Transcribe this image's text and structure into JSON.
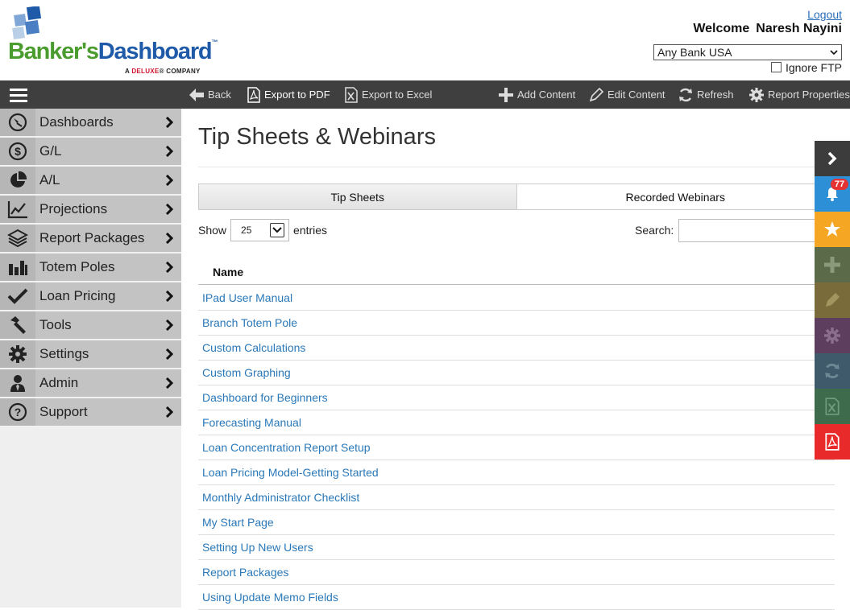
{
  "header": {
    "logo_text_1": "Banker's",
    "logo_text_2": "Dashboard",
    "logo_tm": "™",
    "logo_sub_1": "A",
    "logo_sub_2": "DELUXE",
    "logo_sub_3": "® COMPANY",
    "logout": "Logout",
    "welcome": "Welcome",
    "user_name": "Naresh Nayini",
    "bank": "Any Bank USA",
    "ignore_ftp": "Ignore FTP"
  },
  "toolbar": {
    "back": "Back",
    "export_pdf": "Export to PDF",
    "export_excel": "Export to Excel",
    "add_content": "Add Content",
    "edit_content": "Edit Content",
    "refresh": "Refresh",
    "report_properties": "Report Properties"
  },
  "sidebar": {
    "items": [
      {
        "label": "Dashboards",
        "icon": "dashboard-icon"
      },
      {
        "label": "G/L",
        "icon": "dollar-icon"
      },
      {
        "label": "A/L",
        "icon": "pie-icon"
      },
      {
        "label": "Projections",
        "icon": "line-chart-icon"
      },
      {
        "label": "Report Packages",
        "icon": "layers-icon"
      },
      {
        "label": "Totem Poles",
        "icon": "bar-chart-icon"
      },
      {
        "label": "Loan Pricing",
        "icon": "check-icon"
      },
      {
        "label": "Tools",
        "icon": "hammer-icon"
      },
      {
        "label": "Settings",
        "icon": "gear-icon"
      },
      {
        "label": "Admin",
        "icon": "user-icon"
      },
      {
        "label": "Support",
        "icon": "help-icon"
      }
    ]
  },
  "main": {
    "title": "Tip Sheets & Webinars",
    "tabs": [
      {
        "label": "Tip Sheets",
        "active": true
      },
      {
        "label": "Recorded Webinars",
        "active": false
      }
    ],
    "show_label": "Show",
    "entries_value": "25",
    "entries_label": "entries",
    "search_label": "Search:",
    "search_value": "",
    "column_name": "Name",
    "rows": [
      "IPad User Manual",
      "Branch Totem Pole",
      "Custom Calculations",
      "Custom Graphing",
      "Dashboard for Beginners",
      "Forecasting Manual",
      "Loan Concentration Report Setup",
      "Loan Pricing Model-Getting Started",
      "Monthly Administrator Checklist",
      "My Start Page",
      "Setting Up New Users",
      "Report Packages",
      "Using Update Memo Fields"
    ]
  },
  "right_panel": {
    "notification_count": "77",
    "colors": {
      "expand": "#3c3c3c",
      "notifications": "#2d8fd5",
      "favorites": "#f5a623",
      "add": "#5b6b4a",
      "edit": "#7a6c3a",
      "settings": "#5e3e5e",
      "refresh": "#3f5a6b",
      "excel": "#3e6b4c",
      "pdf": "#e82a2a"
    }
  }
}
